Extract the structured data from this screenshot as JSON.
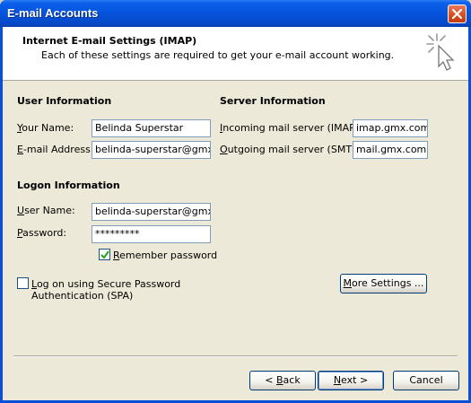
{
  "window": {
    "title": "E-mail Accounts"
  },
  "header": {
    "title": "Internet E-mail Settings (IMAP)",
    "subtitle": "Each of these settings are required to get your e-mail account working."
  },
  "user_info": {
    "section_title": "User Information",
    "your_name": {
      "label_u": "Y",
      "label_rest": "our Name:",
      "value": "Belinda Superstar"
    },
    "email": {
      "label_u": "E",
      "label_rest": "-mail Address:",
      "value": "belinda-superstar@gmx.cc"
    }
  },
  "server_info": {
    "section_title": "Server Information",
    "incoming": {
      "label_u": "I",
      "label_rest": "ncoming mail server (IMAP):",
      "value": "imap.gmx.com"
    },
    "outgoing": {
      "label_u": "O",
      "label_rest": "utgoing mail server (SMTP):",
      "value": "mail.gmx.com"
    }
  },
  "logon_info": {
    "section_title": "Logon Information",
    "user_name": {
      "label_u": "U",
      "label_rest": "ser Name:",
      "value": "belinda-superstar@gmx.cc"
    },
    "password": {
      "label_u": "P",
      "label_rest": "assword:",
      "value": "*********"
    },
    "remember": {
      "label_u": "R",
      "label_rest": "emember password",
      "checked": true
    }
  },
  "spa": {
    "label_line1_u": "L",
    "label_line1_rest": "og on using Secure Password",
    "label_line2": "Authentication (SPA)",
    "checked": false
  },
  "buttons": {
    "more_settings_u": "M",
    "more_settings_rest": "ore Settings ...",
    "back_arrow": "< ",
    "back_u": "B",
    "back_rest": "ack",
    "next_u": "N",
    "next_rest": "ext >",
    "cancel": "Cancel"
  },
  "colors": {
    "titlebar": "#0654dc",
    "dialog_bg": "#ece9d8",
    "field_border": "#7f9db9",
    "checkmark": "#21a121"
  }
}
